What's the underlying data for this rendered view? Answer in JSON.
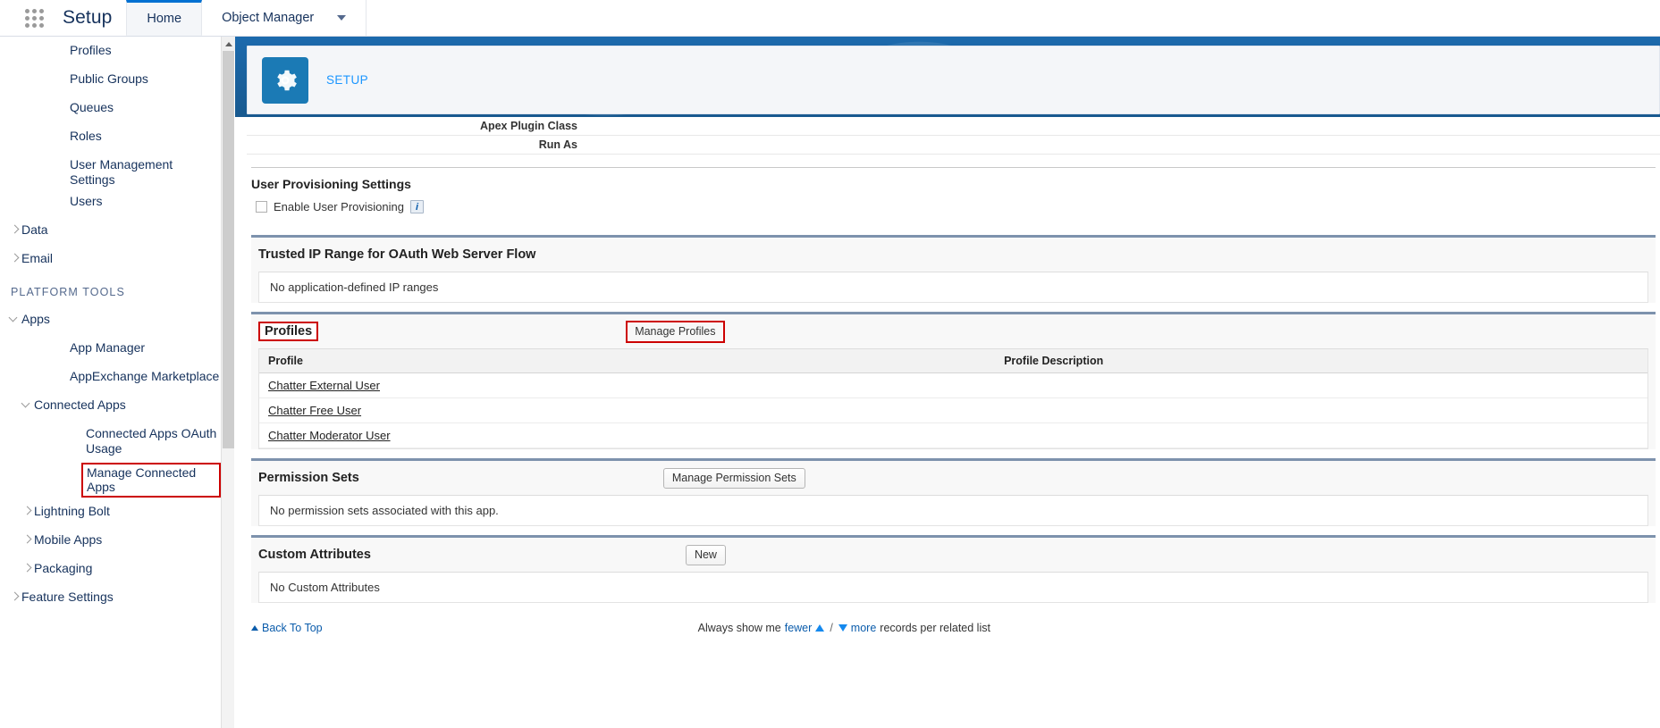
{
  "header": {
    "app_title": "Setup",
    "waffle_icon": "app-launcher-waffle-icon",
    "tabs": [
      {
        "label": "Home",
        "active": true
      },
      {
        "label": "Object Manager",
        "active": false,
        "has_caret": true
      }
    ]
  },
  "sidebar": {
    "items": [
      {
        "label": "Profiles",
        "level": 2,
        "twisty": "none"
      },
      {
        "label": "Public Groups",
        "level": 2,
        "twisty": "none"
      },
      {
        "label": "Queues",
        "level": 2,
        "twisty": "none"
      },
      {
        "label": "Roles",
        "level": 2,
        "twisty": "none"
      },
      {
        "label": "User Management Settings",
        "level": 2,
        "twisty": "none"
      },
      {
        "label": "Users",
        "level": 2,
        "twisty": "none"
      },
      {
        "label": "Data",
        "level": 0,
        "twisty": "collapsed"
      },
      {
        "label": "Email",
        "level": 0,
        "twisty": "collapsed"
      }
    ],
    "section_label": "PLATFORM TOOLS",
    "platform_items": [
      {
        "label": "Apps",
        "level": 0,
        "twisty": "expanded"
      },
      {
        "label": "App Manager",
        "level": 2,
        "twisty": "none"
      },
      {
        "label": "AppExchange Marketplace",
        "level": 2,
        "twisty": "none"
      },
      {
        "label": "Connected Apps",
        "level": 1,
        "twisty": "expanded"
      },
      {
        "label": "Connected Apps OAuth Usage",
        "level": 3,
        "twisty": "none"
      },
      {
        "label": "Manage Connected Apps",
        "level": 3,
        "twisty": "none",
        "highlighted": true
      },
      {
        "label": "Lightning Bolt",
        "level": 1,
        "twisty": "collapsed"
      },
      {
        "label": "Mobile Apps",
        "level": 1,
        "twisty": "collapsed"
      },
      {
        "label": "Packaging",
        "level": 1,
        "twisty": "collapsed"
      },
      {
        "label": "Feature Settings",
        "level": 0,
        "twisty": "collapsed"
      }
    ]
  },
  "setup_card": {
    "gear_icon": "gear-icon",
    "breadcrumb": "SETUP"
  },
  "detail": {
    "fields": [
      {
        "label": "Apex Plugin Class",
        "value": ""
      },
      {
        "label": "Run As",
        "value": ""
      }
    ],
    "user_provisioning": {
      "title": "User Provisioning Settings",
      "checkbox_label": "Enable User Provisioning",
      "checked": false,
      "info_glyph": "i"
    },
    "trusted_ip": {
      "title": "Trusted IP Range for OAuth Web Server Flow",
      "empty_message": "No application-defined IP ranges"
    },
    "profiles": {
      "title": "Profiles",
      "title_highlighted": true,
      "button_label": "Manage Profiles",
      "button_highlighted": true,
      "columns": [
        "Profile",
        "Profile Description"
      ],
      "rows": [
        {
          "profile": "Chatter External User",
          "description": ""
        },
        {
          "profile": "Chatter Free User",
          "description": ""
        },
        {
          "profile": "Chatter Moderator User",
          "description": ""
        }
      ]
    },
    "permission_sets": {
      "title": "Permission Sets",
      "button_label": "Manage Permission Sets",
      "empty_message": "No permission sets associated with this app."
    },
    "custom_attributes": {
      "title": "Custom Attributes",
      "button_label": "New",
      "empty_message": "No Custom Attributes"
    },
    "footer": {
      "back_to_top": "Back To Top",
      "show_prefix": "Always show me",
      "fewer_label": "fewer",
      "separator": "/",
      "more_label": "more",
      "show_suffix": "records per related list"
    }
  },
  "colors": {
    "brand_blue": "#1b5f9e",
    "link_blue": "#0b5cab",
    "annotation_red": "#cc0000",
    "panel_rule": "#7d92ad"
  }
}
